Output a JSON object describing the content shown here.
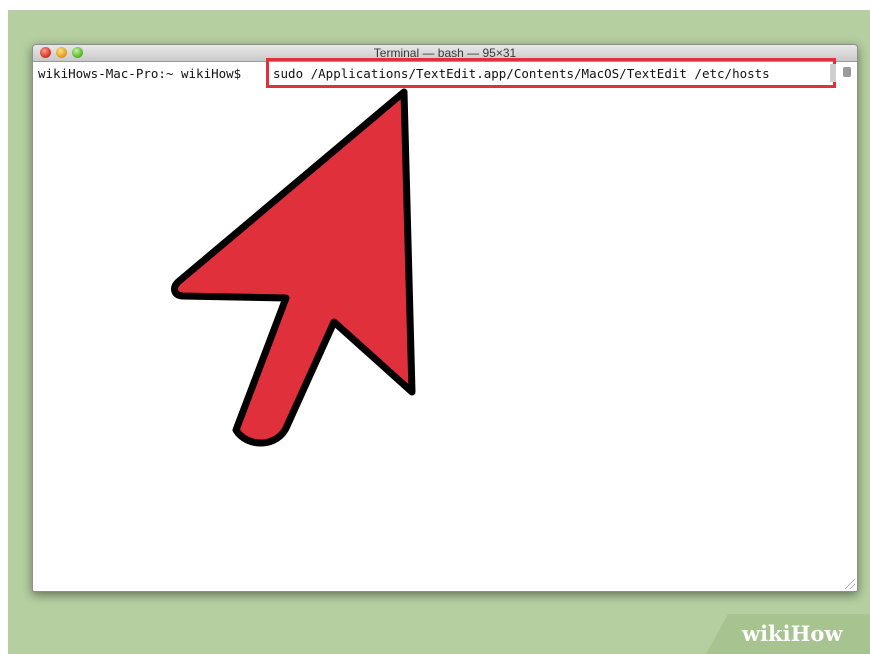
{
  "window": {
    "title": "Terminal — bash — 95×31"
  },
  "terminal": {
    "prompt": "wikiHows-Mac-Pro:~ wikiHow$",
    "command": "sudo /Applications/TextEdit.app/Contents/MacOS/TextEdit /etc/hosts"
  },
  "watermark": {
    "wiki": "wiki",
    "how": "How"
  },
  "colors": {
    "highlight": "#e0303c",
    "arrow_fill": "#e0303c",
    "background_green": "#b5cfa0"
  },
  "icons": [
    "close-icon",
    "minimize-icon",
    "zoom-icon",
    "resize-grip-icon",
    "pointer-arrow"
  ]
}
